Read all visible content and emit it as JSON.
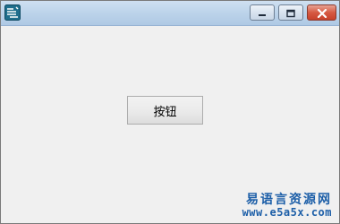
{
  "window": {
    "icon": "app-logo-icon",
    "controls": {
      "minimize_icon": "minimize-icon",
      "maximize_icon": "maximize-icon",
      "close_icon": "close-icon"
    }
  },
  "main": {
    "button_label": "按钮"
  },
  "watermark": {
    "site_name": "易语言资源网",
    "url": "www.e5a5x.com"
  },
  "colors": {
    "close_button": "#c7412a",
    "watermark": "#1d5fa8"
  }
}
